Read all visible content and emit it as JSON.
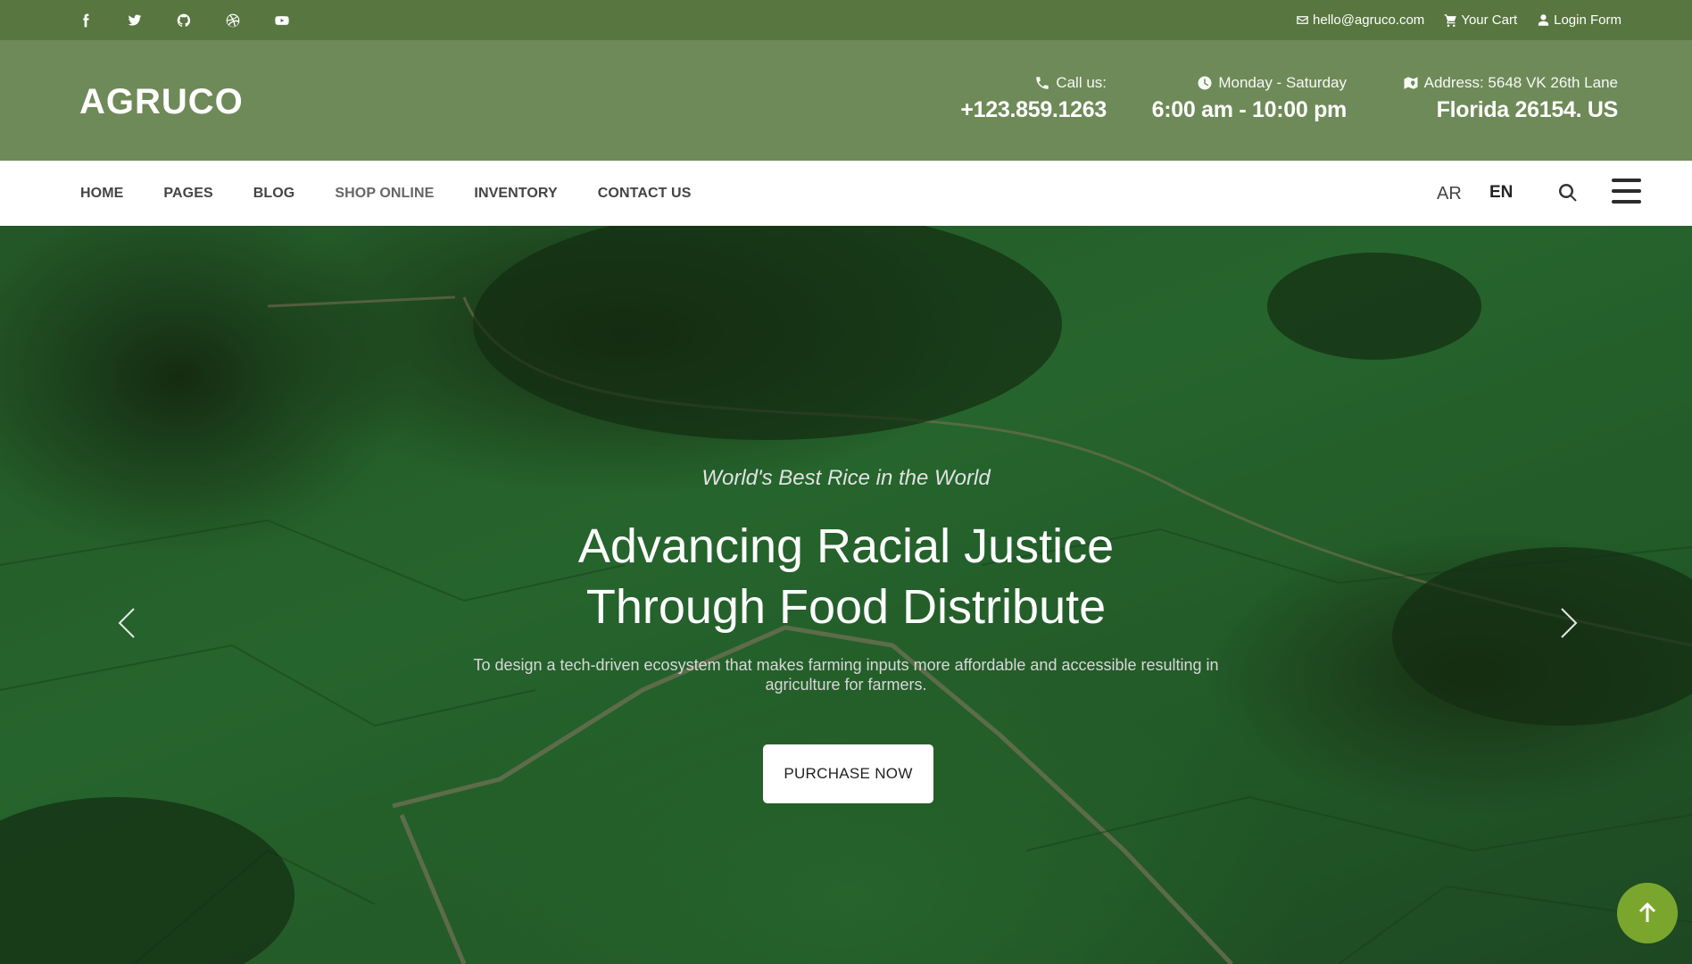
{
  "topbar": {
    "social_icons": [
      "facebook-icon",
      "twitter-icon",
      "github-icon",
      "dribbble-icon",
      "youtube-icon"
    ],
    "email": "hello@agruco.com",
    "cart": "Your Cart",
    "login": "Login Form"
  },
  "header": {
    "logo": "AGRUCO",
    "call_label": "Call us:",
    "call_value": "+123.859.1263",
    "hours_label": "Monday - Saturday",
    "hours_value": "6:00 am - 10:00 pm",
    "address_label": "Address: 5648 VK 26th Lane",
    "address_value": "Florida 26154. US"
  },
  "nav": {
    "items": [
      {
        "label": "HOME"
      },
      {
        "label": "PAGES"
      },
      {
        "label": "BLOG"
      },
      {
        "label": "SHOP ONLINE"
      },
      {
        "label": "INVENTORY"
      },
      {
        "label": "CONTACT US"
      }
    ],
    "lang_ar": "AR",
    "lang_en": "EN"
  },
  "hero": {
    "subtitle": "World's Best Rice in the World",
    "title_line1": "Advancing Racial Justice",
    "title_line2": "Through Food Distribute",
    "description": "To design a tech-driven ecosystem that makes farming inputs more affordable and accessible resulting in agriculture for farmers.",
    "cta": "PURCHASE NOW"
  },
  "colors": {
    "topbar": "#587640",
    "header": "#6e8a58",
    "scroll_top": "#7ba62e"
  }
}
